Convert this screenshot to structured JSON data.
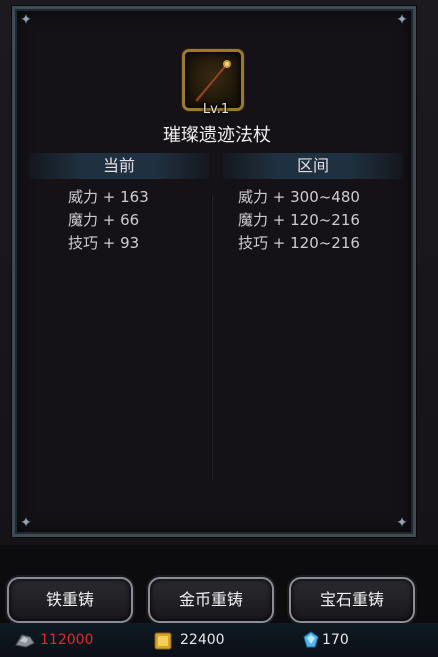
{
  "item": {
    "level": "Lv.1",
    "name": "璀璨遗迹法杖",
    "icon": "staff-icon"
  },
  "columns": {
    "current_label": "当前",
    "range_label": "区间"
  },
  "current_stats": [
    "威力 + 163",
    "魔力 + 66",
    "技巧 + 93"
  ],
  "range_stats": [
    "威力 + 300~480",
    "魔力 + 120~216",
    "技巧 + 120~216"
  ],
  "buttons": {
    "iron_reforge": "铁重铸",
    "gold_reforge": "金币重铸",
    "gem_reforge": "宝石重铸"
  },
  "resources": {
    "iron": "112000",
    "iron_color": "#e02a2a",
    "gold": "22400",
    "gem": "170"
  }
}
